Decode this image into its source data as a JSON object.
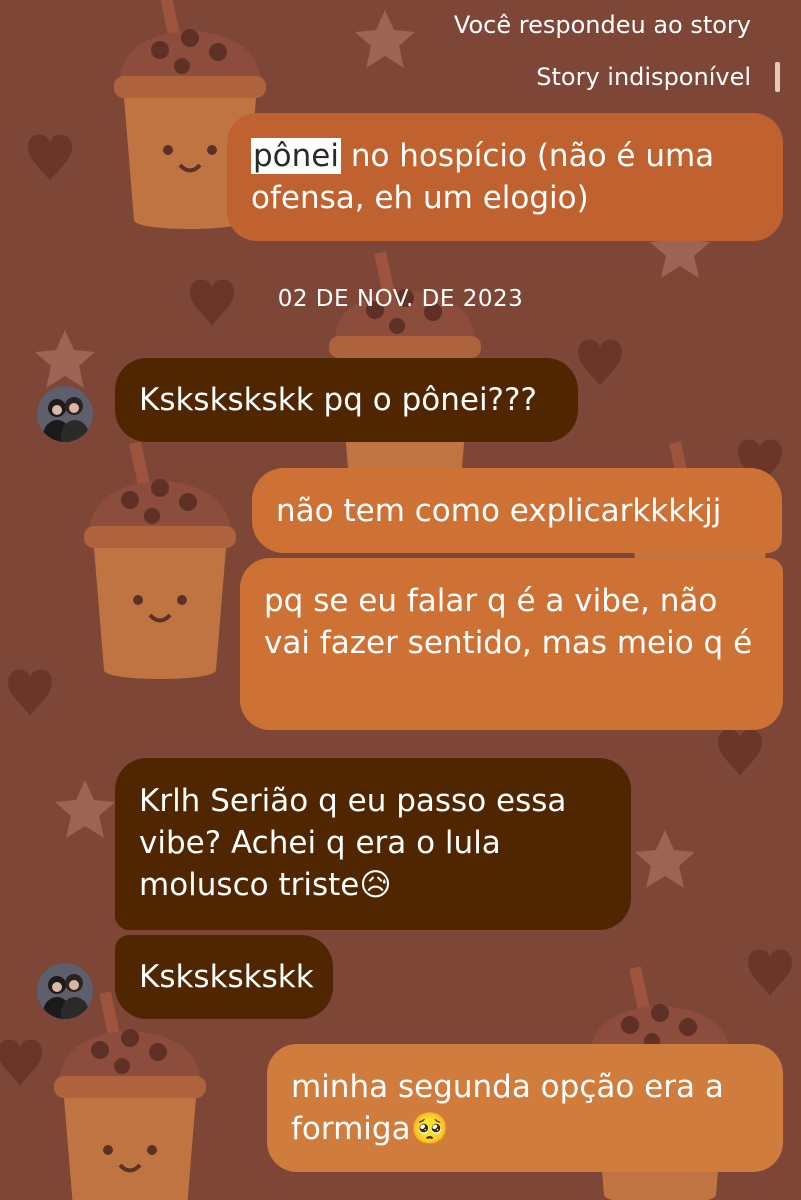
{
  "story": {
    "replied_label": "Você respondeu ao story",
    "unavailable_label": "Story indisponível"
  },
  "date_separator": "02 DE NOV. DE 2023",
  "messages": [
    {
      "id": "m1",
      "direction": "outgoing",
      "highlight": "pônei",
      "text": " no hospício (não é uma ofensa, eh um elogio)"
    },
    {
      "id": "m2",
      "direction": "incoming",
      "text": "Kskskskskk pq o pônei???"
    },
    {
      "id": "m3",
      "direction": "outgoing",
      "text": "não tem como explicarkkkkjj"
    },
    {
      "id": "m4",
      "direction": "outgoing",
      "text": "pq se eu falar q é a vibe, não vai fazer sentido, mas meio q é"
    },
    {
      "id": "m5",
      "direction": "incoming",
      "text": "Krlh Serião q eu passo essa vibe? Achei q era o lula molusco triste😥"
    },
    {
      "id": "m6",
      "direction": "incoming",
      "text": "Kskskskskk"
    },
    {
      "id": "m7",
      "direction": "outgoing",
      "text": "minha segunda opção era a formiga🥺"
    }
  ],
  "colors": {
    "background": "#7d4637",
    "outgoing_bubble": "#c0622f",
    "incoming_bubble": "#4f2600",
    "text": "#ffffff"
  }
}
